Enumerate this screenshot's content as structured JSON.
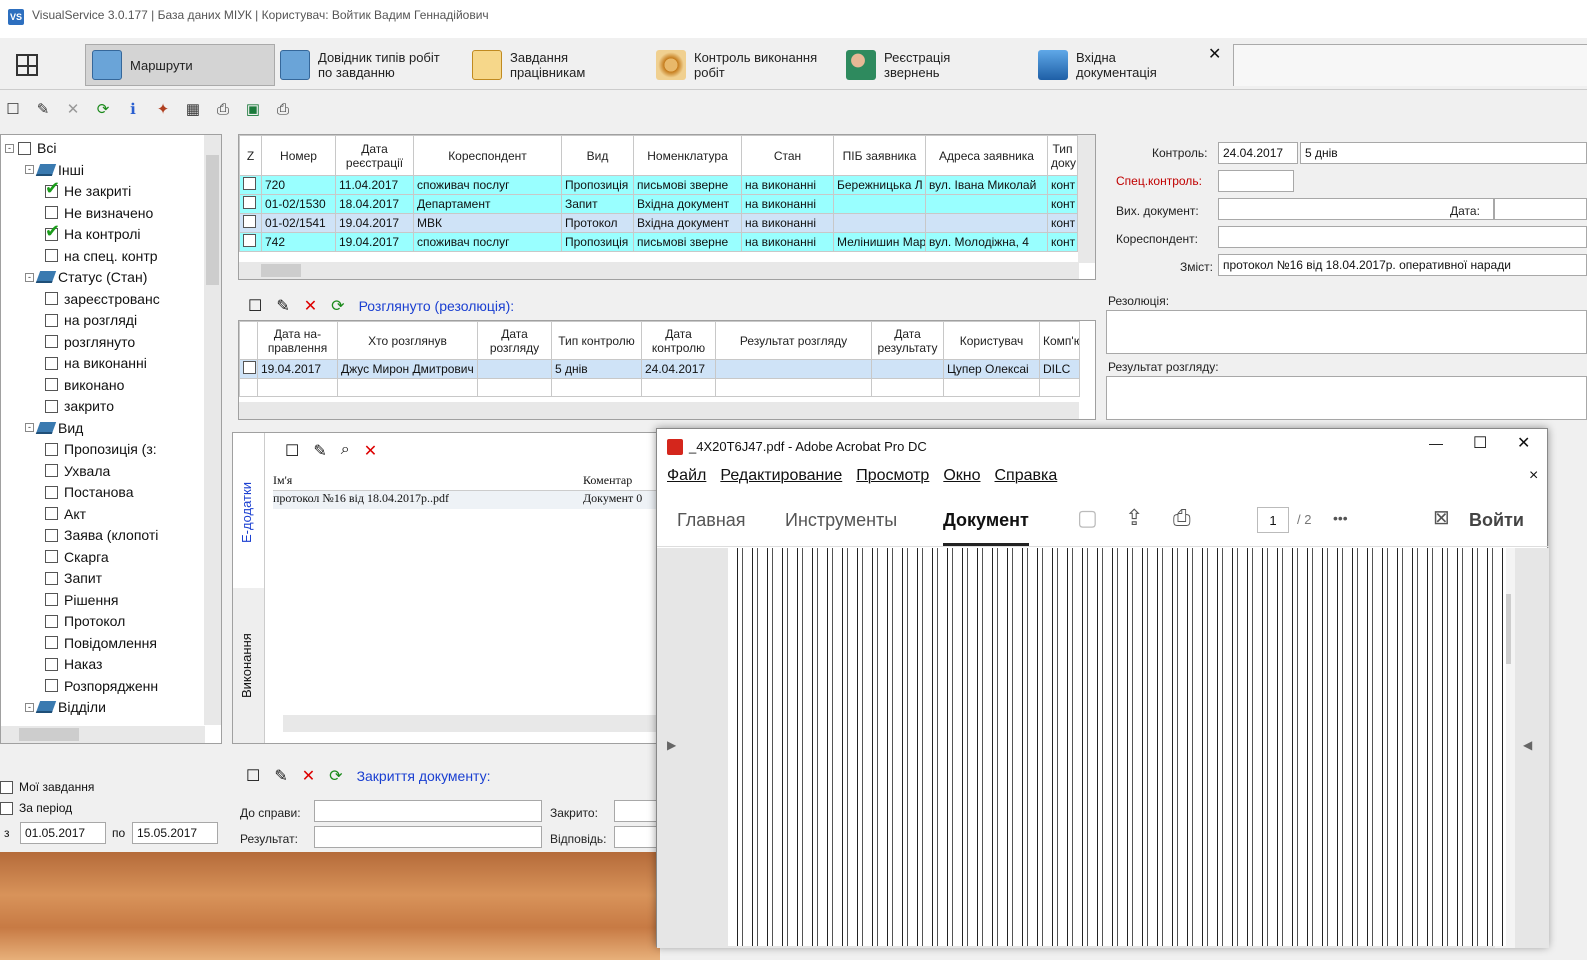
{
  "window": {
    "title": "VisualService 3.0.177 | База даних МІУК | Користувач: Войтик Вадим Геннадійович",
    "app_icon": "VS"
  },
  "tabs": [
    {
      "label": "Маршрути",
      "icon": "book-icon"
    },
    {
      "label": "Довідник типів робіт по завданню",
      "icon": "book-icon"
    },
    {
      "label": "Завдання працівникам",
      "icon": "list-icon"
    },
    {
      "label": "Контроль виконання робіт",
      "icon": "gears-icon"
    },
    {
      "label": "Реєстрація звернень",
      "icon": "person-icon"
    },
    {
      "label": "Вхідна документація",
      "icon": "tray-icon"
    }
  ],
  "tab_close": "✕",
  "tree": {
    "items": [
      {
        "label": "Всі",
        "level": 0,
        "type": "check",
        "checked": false,
        "pm": "-"
      },
      {
        "label": "Інші",
        "level": 1,
        "type": "folder",
        "pm": "-"
      },
      {
        "label": "Не закриті",
        "level": 2,
        "type": "check",
        "checked": true
      },
      {
        "label": "Не визначено",
        "level": 2,
        "type": "check",
        "checked": false
      },
      {
        "label": "На контролі",
        "level": 2,
        "type": "check",
        "checked": true
      },
      {
        "label": "на спец. контр",
        "level": 2,
        "type": "check",
        "checked": false
      },
      {
        "label": "Статус (Стан)",
        "level": 1,
        "type": "folder",
        "pm": "-"
      },
      {
        "label": "зареєстрованс",
        "level": 2,
        "type": "check",
        "checked": false
      },
      {
        "label": "на розгляді",
        "level": 2,
        "type": "check",
        "checked": false
      },
      {
        "label": "розглянуто",
        "level": 2,
        "type": "check",
        "checked": false
      },
      {
        "label": "на виконанні",
        "level": 2,
        "type": "check",
        "checked": false
      },
      {
        "label": "виконано",
        "level": 2,
        "type": "check",
        "checked": false
      },
      {
        "label": "закрито",
        "level": 2,
        "type": "check",
        "checked": false
      },
      {
        "label": "Вид",
        "level": 1,
        "type": "folder",
        "pm": "-"
      },
      {
        "label": "Пропозиція (з:",
        "level": 2,
        "type": "check",
        "checked": false
      },
      {
        "label": "Ухвала",
        "level": 2,
        "type": "check",
        "checked": false
      },
      {
        "label": "Постанова",
        "level": 2,
        "type": "check",
        "checked": false
      },
      {
        "label": "Акт",
        "level": 2,
        "type": "check",
        "checked": false
      },
      {
        "label": "Заява (клопоті",
        "level": 2,
        "type": "check",
        "checked": false
      },
      {
        "label": "Скарга",
        "level": 2,
        "type": "check",
        "checked": false
      },
      {
        "label": "Запит",
        "level": 2,
        "type": "check",
        "checked": false
      },
      {
        "label": "Рішення",
        "level": 2,
        "type": "check",
        "checked": false
      },
      {
        "label": "Протокол",
        "level": 2,
        "type": "check",
        "checked": false
      },
      {
        "label": "Повідомлення",
        "level": 2,
        "type": "check",
        "checked": false
      },
      {
        "label": "Наказ",
        "level": 2,
        "type": "check",
        "checked": false
      },
      {
        "label": "Розпорядженн",
        "level": 2,
        "type": "check",
        "checked": false
      },
      {
        "label": "Відділи",
        "level": 1,
        "type": "folder",
        "pm": "-"
      }
    ]
  },
  "filters": {
    "my_tasks": "Мої завдання",
    "period": "За період",
    "from_prefix": "з",
    "from": "01.05.2017",
    "to_label": "по",
    "to": "15.05.2017"
  },
  "main_table": {
    "headers": [
      "Z",
      "Номер",
      "Дата реєстрації",
      "Кореспондент",
      "Вид",
      "Номенклатура",
      "Стан",
      "ПІБ заявника",
      "Адреса заявника",
      "Тип доку"
    ],
    "rows": [
      [
        "",
        "720",
        "11.04.2017",
        "споживач послуг",
        "Пропозиція",
        "письмові зверне",
        "на виконанні",
        "Бережницька Л",
        "вул. Івана Миколай",
        "конт"
      ],
      [
        "",
        "01-02/1530",
        "18.04.2017",
        "Департамент",
        "Запит",
        "Вхідна документ",
        "на виконанні",
        "",
        "",
        "конт"
      ],
      [
        "",
        "01-02/1541",
        "19.04.2017",
        "МВК",
        "Протокол",
        "Вхідна документ",
        "на виконанні",
        "",
        "",
        "конт"
      ],
      [
        "",
        "742",
        "19.04.2017",
        "споживач послуг",
        "Пропозиція",
        "письмові зверне",
        "на виконанні",
        "Мелінишин Мар",
        "вул. Молодіжна, 4",
        "конт"
      ]
    ],
    "selected_row": 2
  },
  "details": {
    "control_label": "Контроль:",
    "control_date": "24.04.2017",
    "control_period": "5 днів",
    "spec_label": "Спец.контроль:",
    "out_doc_label": "Вих. документ:",
    "date_label": "Дата:",
    "correspondent_label": "Кореспондент:",
    "content_label": "Зміст:",
    "content_value": "протокол №16 від 18.04.2017р. оперативної наради",
    "resolution_label": "Резолюція:",
    "result_label": "Результат розгляду:"
  },
  "review": {
    "title": "Розглянуто (резолюція):",
    "headers": [
      "Дата на-правлення",
      "Хто розглянув",
      "Дата розгляду",
      "Тип контролю",
      "Дата контролю",
      "Результат розгляду",
      "Дата результату",
      "Користувач",
      "Комп'ют"
    ],
    "row": [
      "19.04.2017",
      "Джус Мирон Дмитрович",
      "",
      "5 днів",
      "24.04.2017",
      "",
      "",
      "Цупер Олексаі",
      "DILC"
    ]
  },
  "attachments": {
    "side_tabs": [
      "Е-додатки",
      "Виконання"
    ],
    "headers": [
      "Ім'я",
      "Коментар"
    ],
    "row": [
      "протокол №16 від 18.04.2017р..pdf",
      "Документ 0"
    ]
  },
  "closing": {
    "title": "Закриття документу:",
    "case_label": "До справи:",
    "closed_label": "Закрито:",
    "result_label": "Результат:",
    "answer_label": "Відповідь:"
  },
  "acrobat": {
    "title": "_4X20T6J47.pdf - Adobe Acrobat Pro DC",
    "menu": [
      "Файл",
      "Редактирование",
      "Просмотр",
      "Окно",
      "Справка"
    ],
    "nav": [
      "Главная",
      "Инструменты",
      "Документ"
    ],
    "page_current": "1",
    "page_total": "/ 2",
    "more": "•••",
    "signin": "Войти",
    "controls": {
      "min": "—",
      "max": "☐",
      "close": "✕",
      "close_doc": "×"
    }
  },
  "colors": {
    "accent": "#1a3fd1",
    "highlight": "#99ffff",
    "selected": "#cfe3f7",
    "spec_red": "#c00000"
  }
}
